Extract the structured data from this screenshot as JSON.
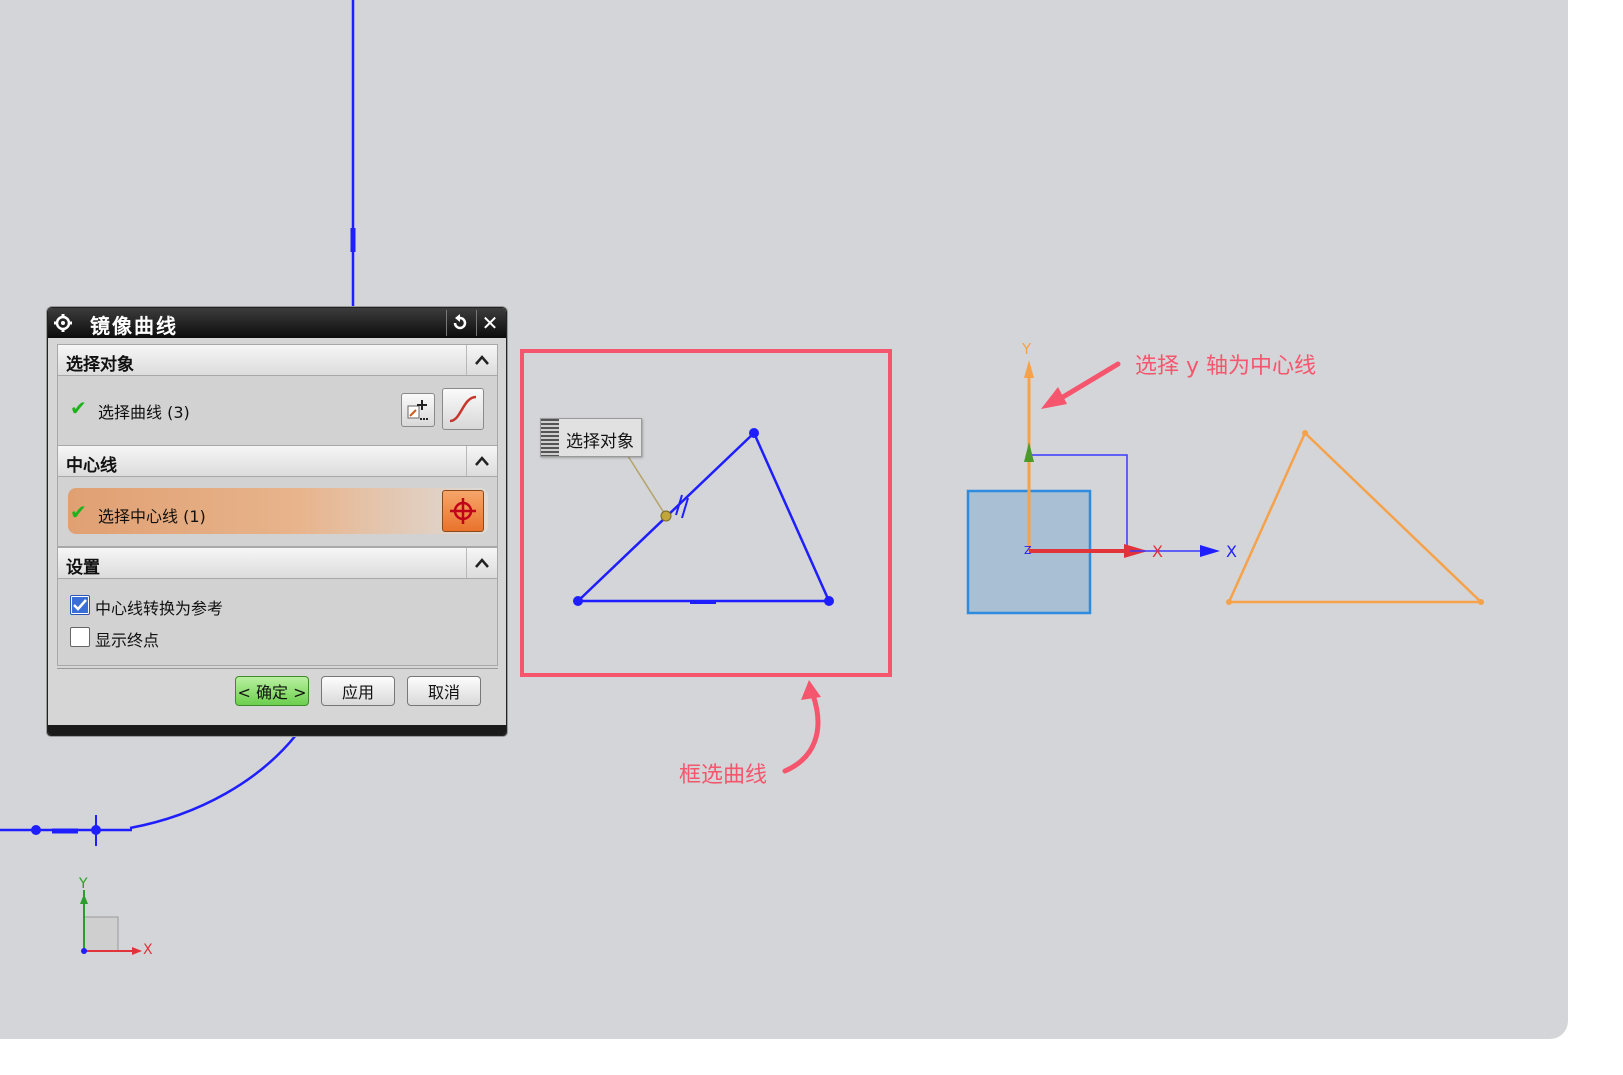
{
  "dialog": {
    "title": "镜像曲线",
    "sections": {
      "select_objects": {
        "title": "选择对象",
        "row_label": "选择曲线 (3)"
      },
      "centerline": {
        "title": "中心线",
        "row_label": "选择中心线 (1)"
      },
      "settings": {
        "title": "设置",
        "options": [
          {
            "label": "中心线转换为参考",
            "checked": true
          },
          {
            "label": "显示终点",
            "checked": false
          }
        ]
      }
    },
    "buttons": {
      "ok": "< 确定 >",
      "apply": "应用",
      "cancel": "取消"
    }
  },
  "viewport": {
    "tooltip": "选择对象",
    "axis_labels": {
      "small_y": "Y",
      "small_x": "X",
      "datum_y": "Y",
      "datum_x": "X",
      "datum_x2": "X",
      "datum_z": "Z"
    }
  },
  "annotations": {
    "box_select": "框选曲线",
    "select_y_axis": "选择 y 轴为中心线"
  },
  "colors": {
    "curve_blue": "#1e1eff",
    "highlight_red": "#f5556d",
    "mirror_orange": "#f5a24a",
    "background": "#d4d5d8"
  }
}
